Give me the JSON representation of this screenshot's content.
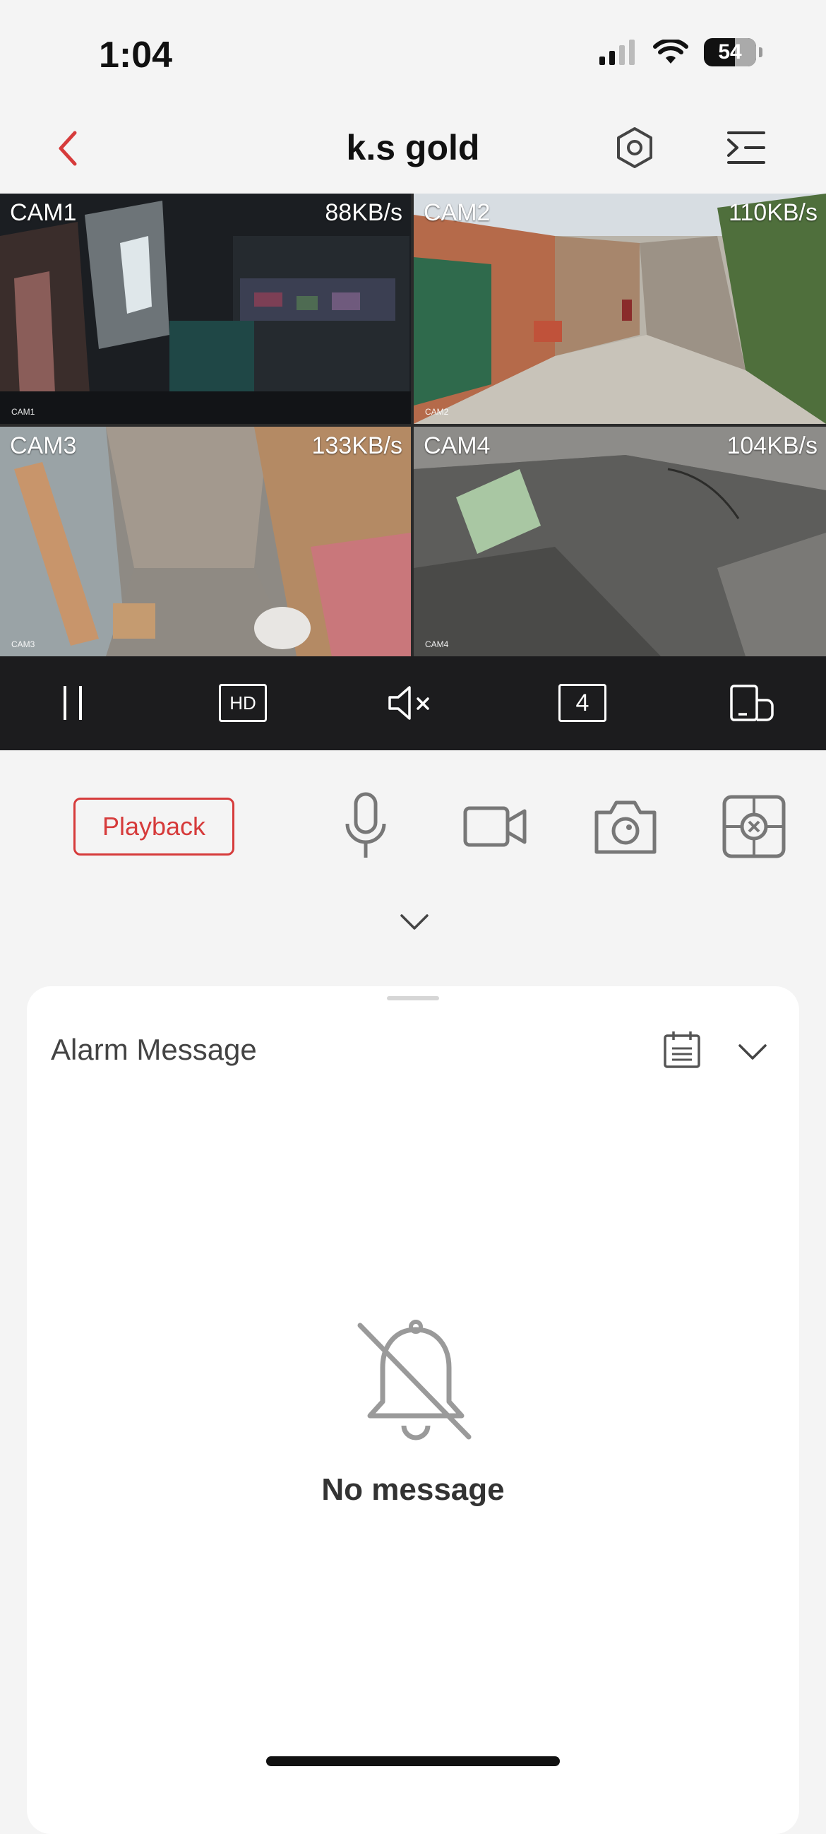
{
  "status_bar": {
    "time": "1:04",
    "battery": "54"
  },
  "header": {
    "title": "k.s gold"
  },
  "cameras": [
    {
      "label": "CAM1",
      "rate": "88KB/s",
      "osd": "CAM1"
    },
    {
      "label": "CAM2",
      "rate": "110KB/s",
      "osd": "CAM2"
    },
    {
      "label": "CAM3",
      "rate": "133KB/s",
      "osd": "CAM3"
    },
    {
      "label": "CAM4",
      "rate": "104KB/s",
      "osd": "CAM4"
    }
  ],
  "toolbar": {
    "quality_label": "HD",
    "split_count": "4"
  },
  "actions": {
    "playback_label": "Playback"
  },
  "alarm": {
    "title": "Alarm Message",
    "empty_text": "No message"
  },
  "colors": {
    "accent": "#d63b3b",
    "toolbar_bg": "#1c1c1e",
    "page_bg": "#f4f4f4"
  },
  "icons": [
    "back-chevron",
    "settings-hexagon",
    "channel-menu",
    "pause",
    "mute",
    "fullscreen-rotate",
    "microphone",
    "video-record",
    "camera-snapshot",
    "ptz-control",
    "calendar",
    "bell-off"
  ]
}
